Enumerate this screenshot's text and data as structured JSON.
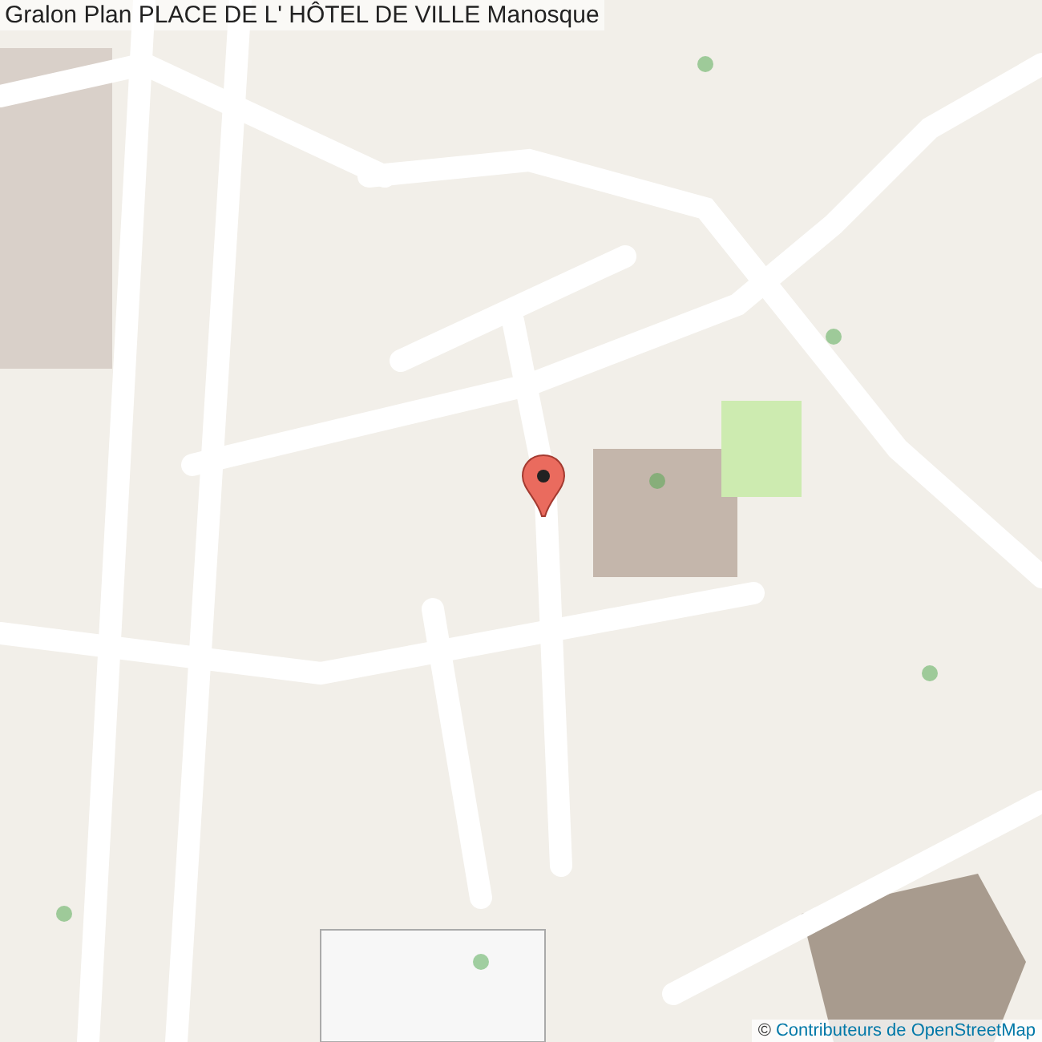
{
  "title": "Gralon Plan PLACE DE L' HÔTEL DE VILLE Manosque",
  "attribution": {
    "symbol": "©",
    "link": "Contributeurs de OpenStreetMap"
  }
}
